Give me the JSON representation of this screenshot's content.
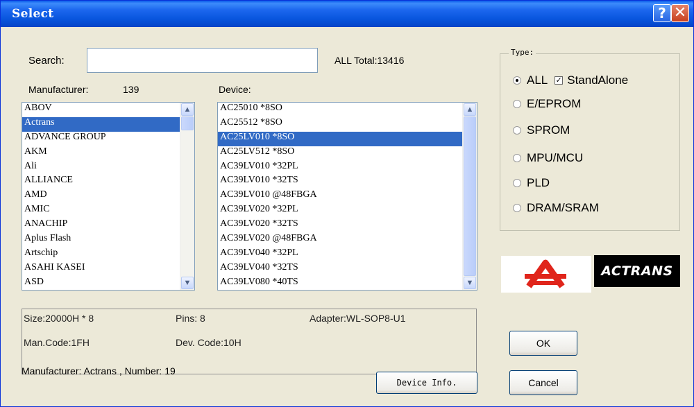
{
  "window": {
    "title": "Select"
  },
  "search": {
    "label": "Search:",
    "value": "",
    "total": "ALL Total:13416"
  },
  "manufacturer": {
    "label": "Manufacturer:",
    "count": "139",
    "items": [
      "ABOV",
      "Actrans",
      "ADVANCE GROUP",
      "AKM",
      "Ali",
      "ALLIANCE",
      "AMD",
      "AMIC",
      "ANACHIP",
      "Aplus Flash",
      "Artschip",
      "ASAHI KASEI",
      "ASD"
    ],
    "selected_index": 1
  },
  "device": {
    "label": "Device:",
    "items": [
      "AC25010 *8SO",
      "AC25512 *8SO",
      "AC25LV010 *8SO",
      "AC25LV512 *8SO",
      "AC39LV010 *32PL",
      "AC39LV010 *32TS",
      "AC39LV010 @48FBGA",
      "AC39LV020 *32PL",
      "AC39LV020 *32TS",
      "AC39LV020 @48FBGA",
      "AC39LV040 *32PL",
      "AC39LV040 *32TS",
      "AC39LV080 *40TS"
    ],
    "selected_index": 2
  },
  "type_group": {
    "title": "Type:",
    "options": [
      "ALL",
      "E/EPROM",
      "SPROM",
      "MPU/MCU",
      "PLD",
      "DRAM/SRAM"
    ],
    "selected": "ALL",
    "standalone_label": "StandAlone",
    "standalone_checked": true
  },
  "info": {
    "size": "Size:20000H * 8",
    "pins": "Pins: 8",
    "adapter": "Adapter:WL-SOP8-U1",
    "man_code": "Man.Code:1FH",
    "dev_code": "Dev. Code:10H"
  },
  "status": "Manufacturer: Actrans , Number: 19",
  "buttons": {
    "device_info": "Device Info.",
    "ok": "OK",
    "cancel": "Cancel"
  },
  "logo": {
    "brand_text": "ACTRANS"
  },
  "colors": {
    "selection": "#316ac5",
    "titlebar": "#0a5be8",
    "face": "#ece9d8"
  }
}
